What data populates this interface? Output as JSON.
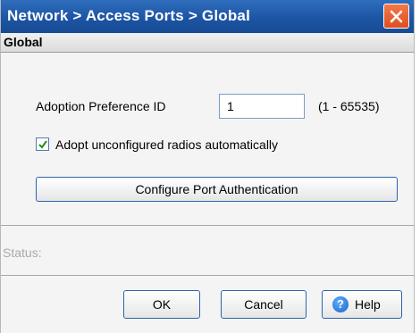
{
  "window": {
    "title": "Network > Access Ports > Global"
  },
  "section": {
    "title": "Global"
  },
  "form": {
    "adoption_label": "Adoption Preference ID",
    "adoption_value": "1",
    "adoption_range": "(1 - 65535)",
    "auto_adopt_label": "Adopt unconfigured radios automatically",
    "auto_adopt_checked": true,
    "configure_button": "Configure Port Authentication"
  },
  "status": {
    "label": "Status:"
  },
  "footer": {
    "ok": "OK",
    "cancel": "Cancel",
    "help": "Help"
  },
  "colors": {
    "title_bar": "#1d55a5",
    "close_button": "#e85d2f",
    "button_border": "#2d63ad"
  }
}
